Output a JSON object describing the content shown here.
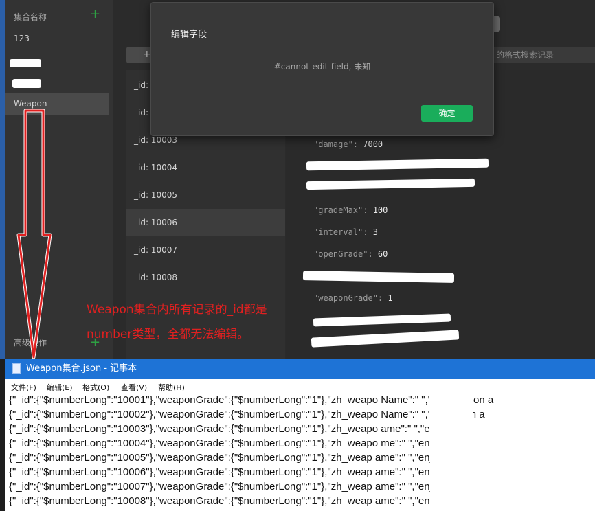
{
  "sidebar": {
    "title": "集合名称",
    "add_icon": "plus-icon",
    "collections": [
      "123",
      "Weapon"
    ],
    "advanced_label": "高级操作"
  },
  "main": {
    "search_placeholder": "的格式搜索记录",
    "ids": [
      "_id:",
      "_id:",
      "_id: 10003",
      "_id: 10004",
      "_id: 10005",
      "_id: 10006",
      "_id: 10007",
      "_id: 10008"
    ],
    "fields": [
      {
        "key": "\"damage\": ",
        "val": "7000"
      },
      {
        "key": "\"gradeMax\": ",
        "val": "100"
      },
      {
        "key": "\"interval\": ",
        "val": "3"
      },
      {
        "key": "\"openGrade\": ",
        "val": "60"
      },
      {
        "key": "\"weaponGrade\": ",
        "val": "1"
      }
    ]
  },
  "dialog": {
    "title": "编辑字段",
    "message": "#cannot-edit-field, 未知",
    "ok_label": "确定"
  },
  "annotation": {
    "line1": "Weapon集合内所有记录的_id都是",
    "line2": "number类型，全都无法编辑。",
    "color": "#e02020"
  },
  "notepad": {
    "title": "Weapon集合.json - 记事本",
    "menu": [
      "文件(F)",
      "编辑(E)",
      "格式(O)",
      "查看(V)",
      "帮助(H)"
    ],
    "lines": [
      "{\"_id\":{\"$numberLong\":\"10001\"},\"weaponGrade\":{\"$numberLong\":\"1\"},\"zh_weapo  Name\":\"      \",\"en_weapon a",
      "{\"_id\":{\"$numberLong\":\"10002\"},\"weaponGrade\":{\"$numberLong\":\"1\"},\"zh_weapo  Name\":\"      \",\"en_we  on a",
      "{\"_id\":{\"$numberLong\":\"10003\"},\"weaponGrade\":{\"$numberLong\":\"1\"},\"zh_weapo   ame\":\"      \",\"en_w   n N",
      "{\"_id\":{\"$numberLong\":\"10004\"},\"weaponGrade\":{\"$numberLong\":\"1\"},\"zh_weapo   me\":\"      \",\"en_we    N",
      "{\"_id\":{\"$numberLong\":\"10005\"},\"weaponGrade\":{\"$numberLong\":\"1\"},\"zh_weap   ame\":\"      \",\"en_we   r  N",
      "{\"_id\":{\"$numberLong\":\"10006\"},\"weaponGrade\":{\"$numberLong\":\"1\"},\"zh_weap  ame\":\"      \",\"en_    n N",
      "{\"_id\":{\"$numberLong\":\"10007\"},\"weaponGrade\":{\"$numberLong\":\"1\"},\"zh_weap  ame\":\"      \",\"en_we   N",
      "{\"_id\":{\"$numberLong\":\"10008\"},\"weaponGrade\":{\"$numberLong\":\"1\"},\"zh_weap  ame\":\"      \",\"en_we   p"
    ]
  }
}
